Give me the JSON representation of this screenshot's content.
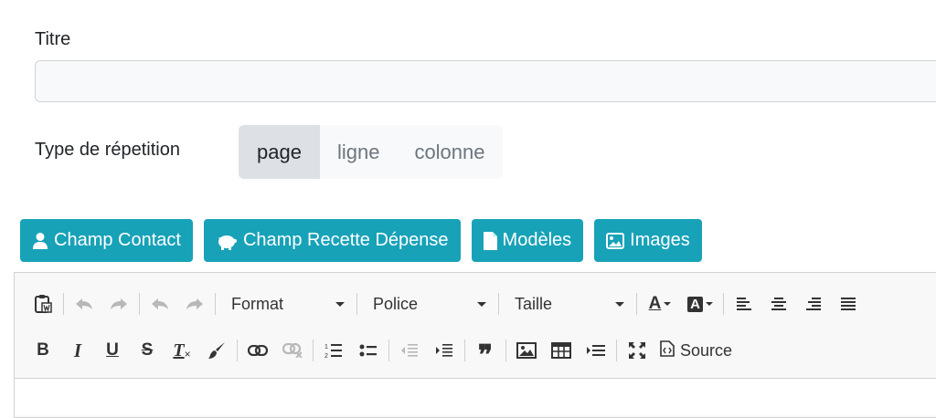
{
  "form": {
    "title_label": "Titre",
    "title_value": "",
    "repeat_label": "Type de répetition",
    "repeat_options": [
      "page",
      "ligne",
      "colonne"
    ],
    "repeat_selected": "page"
  },
  "actions": {
    "contact": "Champ Contact",
    "recette": "Champ Recette Dépense",
    "modeles": "Modèles",
    "images": "Images",
    "accent_color": "#17a2b8"
  },
  "editor": {
    "format_label": "Format",
    "font_label": "Police",
    "size_label": "Taille",
    "source_label": "Source",
    "bold_glyph": "B",
    "italic_glyph": "I",
    "underline_glyph": "U",
    "strike_glyph": "S",
    "clear_glyph": "T",
    "quote_glyph": "❞",
    "text_color_glyph": "A",
    "bg_color_glyph": "A",
    "number_list_glyph": "1 2"
  }
}
